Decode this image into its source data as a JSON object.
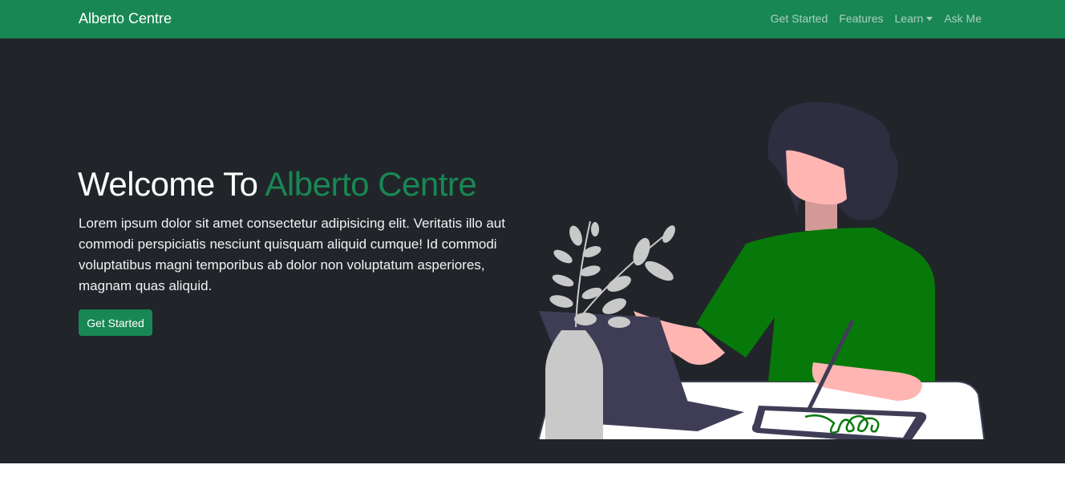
{
  "navbar": {
    "brand": "Alberto Centre",
    "links": [
      {
        "label": "Get Started"
      },
      {
        "label": "Features"
      },
      {
        "label": "Learn",
        "dropdown": true
      },
      {
        "label": "Ask Me"
      }
    ]
  },
  "hero": {
    "title_prefix": "Welcome To ",
    "title_accent": "Alberto Centre",
    "body": "Lorem ipsum dolor sit amet consectetur adipisicing elit. Veritatis illo aut commodi perspiciatis nesciunt quisquam aliquid cumque! Id commodi voluptatibus magni temporibus ab dolor non voluptatum asperiores, magnam quas aliquid.",
    "cta_label": "Get Started"
  },
  "colors": {
    "brand_green": "#198754",
    "hero_bg": "#212529",
    "shirt_green": "#07790a",
    "hair": "#2f2e41",
    "skin": "#ffb6b3",
    "vase": "#c9c9c9",
    "laptop": "#3f3d56"
  },
  "icons": {
    "dropdown": "caret-down-icon",
    "illustration": "woman-drawing-on-tablet-illustration"
  }
}
